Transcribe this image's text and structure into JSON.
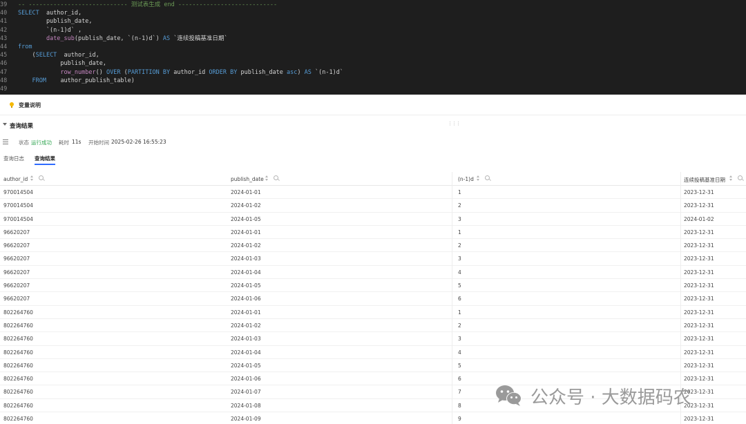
{
  "editor": {
    "lines": [
      {
        "n": "39",
        "parts": [
          [
            "cm",
            "-- ---------------------------- 测试表生成 end ----------------------------"
          ]
        ]
      },
      {
        "n": "40",
        "parts": [
          [
            "kw",
            "SELECT"
          ],
          [
            "st",
            "  author_id,"
          ]
        ]
      },
      {
        "n": "41",
        "parts": [
          [
            "st",
            "        publish_date,"
          ]
        ]
      },
      {
        "n": "42",
        "parts": [
          [
            "st",
            "        `(n-1)d` ,"
          ]
        ]
      },
      {
        "n": "43",
        "parts": [
          [
            "st",
            "        "
          ],
          [
            "fn",
            "date_sub"
          ],
          [
            "st",
            "(publish_date, `(n-1)d`) "
          ],
          [
            "kw",
            "AS"
          ],
          [
            "st",
            " `连续投稿基准日期`"
          ]
        ]
      },
      {
        "n": "44",
        "parts": [
          [
            "kw",
            "from"
          ]
        ]
      },
      {
        "n": "45",
        "parts": [
          [
            "st",
            "    ("
          ],
          [
            "kw",
            "SELECT"
          ],
          [
            "st",
            "  author_id,"
          ]
        ]
      },
      {
        "n": "46",
        "parts": [
          [
            "st",
            "            publish_date,"
          ]
        ]
      },
      {
        "n": "47",
        "parts": [
          [
            "st",
            "            "
          ],
          [
            "fn",
            "row_number"
          ],
          [
            "st",
            "() "
          ],
          [
            "kw",
            "OVER"
          ],
          [
            "st",
            " ("
          ],
          [
            "kw",
            "PARTITION BY"
          ],
          [
            "st",
            " author_id "
          ],
          [
            "kw",
            "ORDER BY"
          ],
          [
            "st",
            " publish_date "
          ],
          [
            "kw",
            "asc"
          ],
          [
            "st",
            ") "
          ],
          [
            "kw",
            "AS"
          ],
          [
            "st",
            " `(n-1)d`"
          ]
        ]
      },
      {
        "n": "48",
        "parts": [
          [
            "st",
            "    "
          ],
          [
            "kw",
            "FROM"
          ],
          [
            "st",
            "    author_publish_table)"
          ]
        ]
      },
      {
        "n": "49",
        "parts": [
          [
            "st",
            ""
          ]
        ]
      }
    ]
  },
  "variables": {
    "label": "变量说明",
    "icon": "lightbulb-icon"
  },
  "results": {
    "title": "查询结果",
    "status_label": "状态",
    "status_value": "运行成功",
    "duration_label": "耗时",
    "duration_value": "11s",
    "start_label": "开始时间",
    "start_value": "2025-02-26 16:55:23"
  },
  "tabs": [
    {
      "label": "查询日志",
      "active": false
    },
    {
      "label": "查询结果",
      "active": true
    }
  ],
  "table": {
    "columns": [
      "author_id",
      "publish_date",
      "(n-1)d",
      "连续投稿基准日期"
    ],
    "rows": [
      [
        "970014504",
        "2024-01-01",
        "1",
        "2023-12-31"
      ],
      [
        "970014504",
        "2024-01-02",
        "2",
        "2023-12-31"
      ],
      [
        "970014504",
        "2024-01-05",
        "3",
        "2024-01-02"
      ],
      [
        "96620207",
        "2024-01-01",
        "1",
        "2023-12-31"
      ],
      [
        "96620207",
        "2024-01-02",
        "2",
        "2023-12-31"
      ],
      [
        "96620207",
        "2024-01-03",
        "3",
        "2023-12-31"
      ],
      [
        "96620207",
        "2024-01-04",
        "4",
        "2023-12-31"
      ],
      [
        "96620207",
        "2024-01-05",
        "5",
        "2023-12-31"
      ],
      [
        "96620207",
        "2024-01-06",
        "6",
        "2023-12-31"
      ],
      [
        "802264760",
        "2024-01-01",
        "1",
        "2023-12-31"
      ],
      [
        "802264760",
        "2024-01-02",
        "2",
        "2023-12-31"
      ],
      [
        "802264760",
        "2024-01-03",
        "3",
        "2023-12-31"
      ],
      [
        "802264760",
        "2024-01-04",
        "4",
        "2023-12-31"
      ],
      [
        "802264760",
        "2024-01-05",
        "5",
        "2023-12-31"
      ],
      [
        "802264760",
        "2024-01-06",
        "6",
        "2023-12-31"
      ],
      [
        "802264760",
        "2024-01-07",
        "7",
        "2023-12-31"
      ],
      [
        "802264760",
        "2024-01-08",
        "8",
        "2023-12-31"
      ],
      [
        "802264760",
        "2024-01-09",
        "9",
        "2023-12-31"
      ]
    ]
  },
  "watermark": {
    "text": "公众号 · 大数据码农",
    "icon": "wechat-icon"
  },
  "colors": {
    "accent": "#2f6bff",
    "success": "#2ea44f",
    "editor_bg": "#1e1e1e",
    "keyword": "#569cd6",
    "function": "#c586c0",
    "comment": "#6a9955"
  }
}
